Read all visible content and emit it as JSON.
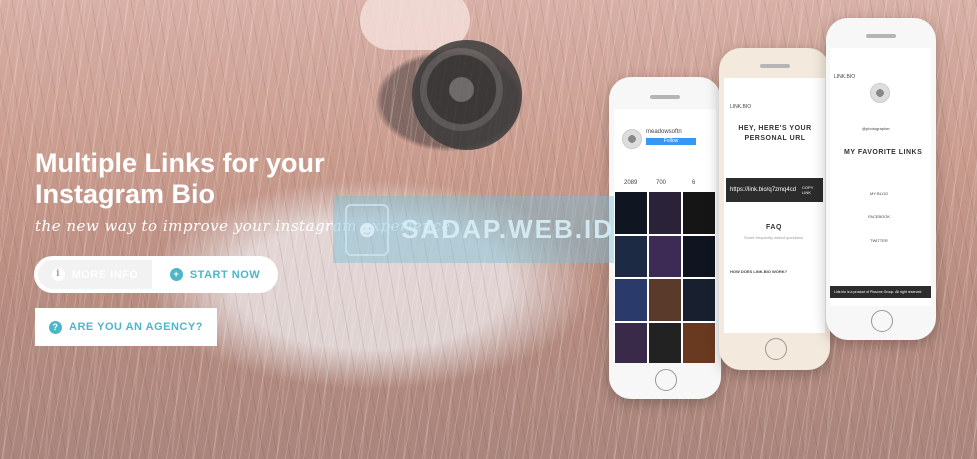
{
  "hero": {
    "title": "Multiple Links for your Instagram Bio",
    "subtitle": "the new way to improve your instagram experience"
  },
  "buttons": {
    "more_info": "MORE INFO",
    "start_now": "START NOW",
    "agency": "ARE YOU AN AGENCY?"
  },
  "watermark": {
    "text": "SADAP.WEB.ID"
  },
  "phones": {
    "left": {
      "username": "meadowsoftn",
      "follow": "Follow",
      "stat1": "2089",
      "stat2": "700",
      "stat3": "6"
    },
    "middle": {
      "brand": "LINK.BIO",
      "headline": "HEY, HERE'S YOUR PERSONAL URL",
      "url": "https://link.bio/q7zmq4cd",
      "copy": "COPY LINK",
      "faq": "FAQ",
      "faq_sub": "Some frequently asked questions",
      "question": "HOW DOES LINK.BIO WORK?"
    },
    "right": {
      "brand": "LINK.BIO",
      "handle": "@photographer",
      "heading": "MY FAVORITE LINKS",
      "link1": "MY BLOG",
      "link2": "FACEBOOK",
      "link3": "TWITTER",
      "footer": "Link.bio is a product of Plusone Group. All right reserved"
    }
  },
  "colors": {
    "accent": "#4db6c9",
    "white": "#ffffff"
  },
  "icons": [
    "info-icon",
    "plus-circle-icon",
    "question-icon"
  ]
}
